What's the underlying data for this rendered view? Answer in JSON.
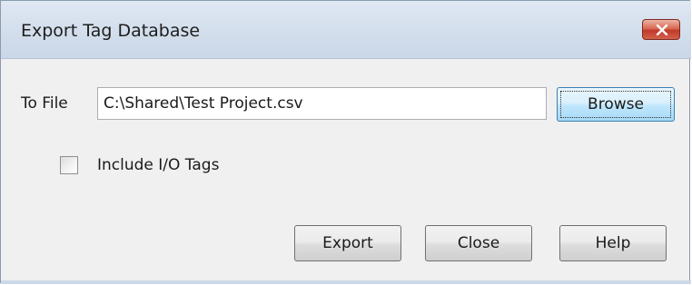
{
  "window": {
    "title": "Export Tag Database",
    "close_icon": "close-x-icon",
    "close_color": "#c0392b"
  },
  "form": {
    "to_file_label": "To File",
    "file_path": "C:\\Shared\\Test Project.csv",
    "browse_label": "Browse",
    "include_io_label": "Include I/O Tags",
    "include_io_checked": false
  },
  "buttons": {
    "export_label": "Export",
    "close_label": "Close",
    "help_label": "Help"
  }
}
